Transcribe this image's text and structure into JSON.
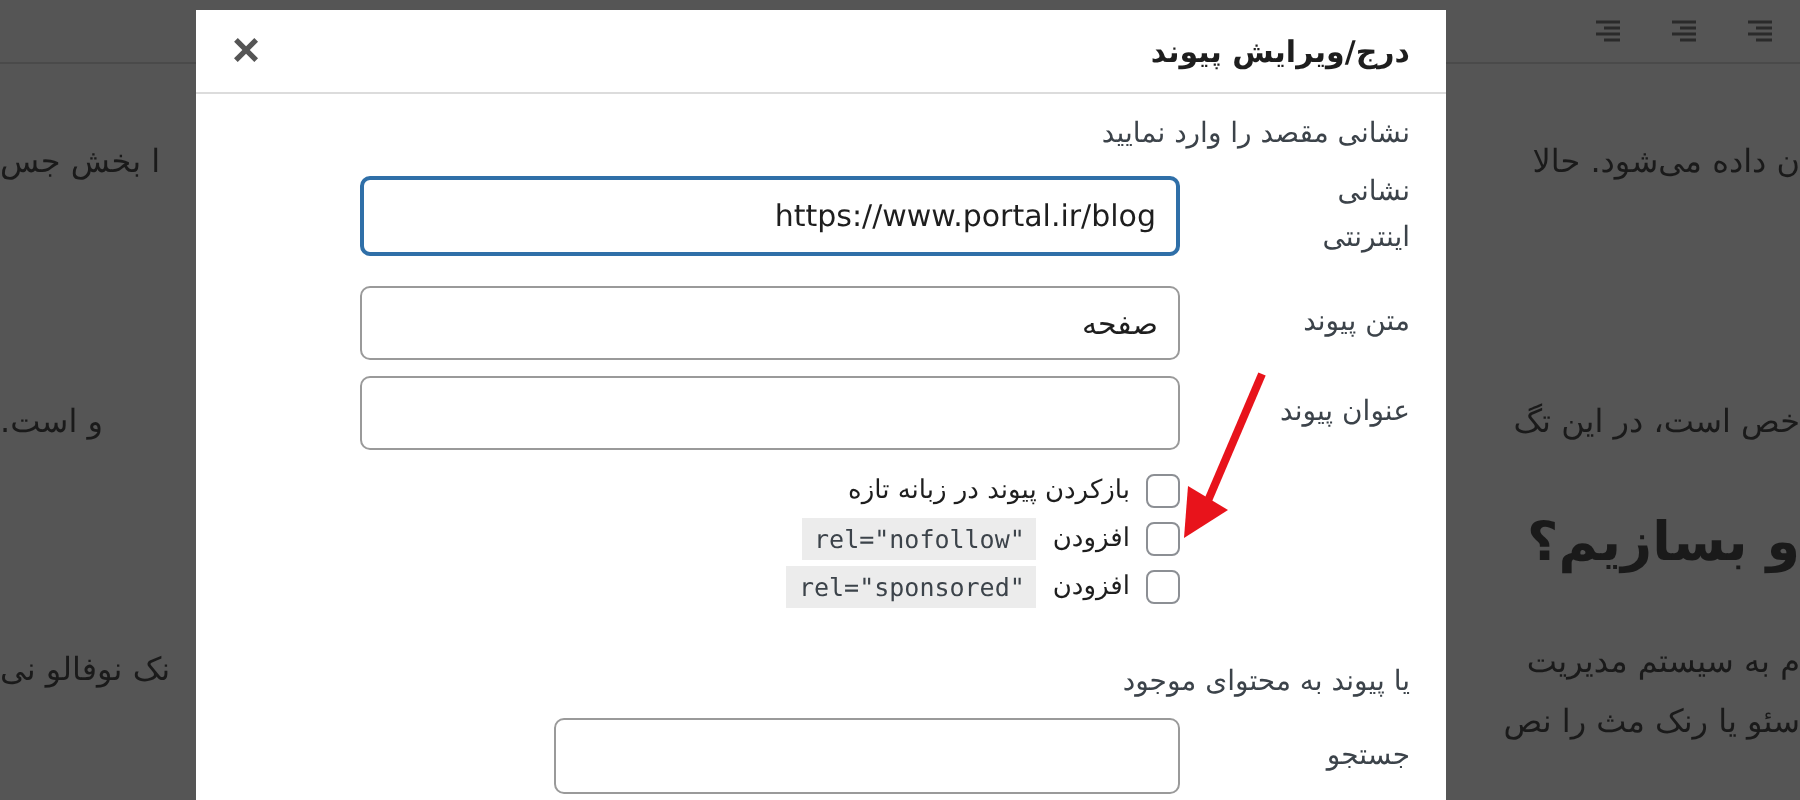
{
  "background": {
    "right_lines": [
      {
        "kind": "text",
        "text": "ن داده می‌شود. حالا"
      },
      {
        "kind": "text",
        "text": "خص است، در این تگ"
      },
      {
        "kind": "heading",
        "text": "و بسازیم؟"
      },
      {
        "kind": "text",
        "text": "م به سیستم مدیریت"
      },
      {
        "kind": "text",
        "text": "سئو یا رنک مث را نص"
      }
    ],
    "left_lines": [
      "ا بخش جس",
      "و است.",
      "نک نوفالو نی"
    ]
  },
  "dialog": {
    "title": "درج/ویرایش پیوند",
    "close": "×",
    "instruction": "نشانی مقصد را وارد نمایید",
    "fields": [
      {
        "label": "نشانی اینترنتی",
        "value": "https://www.portal.ir/blog",
        "focused": true
      },
      {
        "label": "متن پیوند",
        "value": "صفحه",
        "focused": false
      },
      {
        "label": "عنوان پیوند",
        "focused": false
      }
    ],
    "checkboxes": [
      {
        "label": "بازکردن پیوند در زبانه تازه",
        "checked": false
      },
      {
        "label": "افزودن",
        "code": "rel=\"nofollow\"",
        "checked": false
      },
      {
        "label": "افزودن",
        "code": "rel=\"sponsored\"",
        "checked": false
      }
    ],
    "existing_heading": "یا پیوند به محتوای موجود",
    "search": {
      "label": "جستجو"
    }
  }
}
